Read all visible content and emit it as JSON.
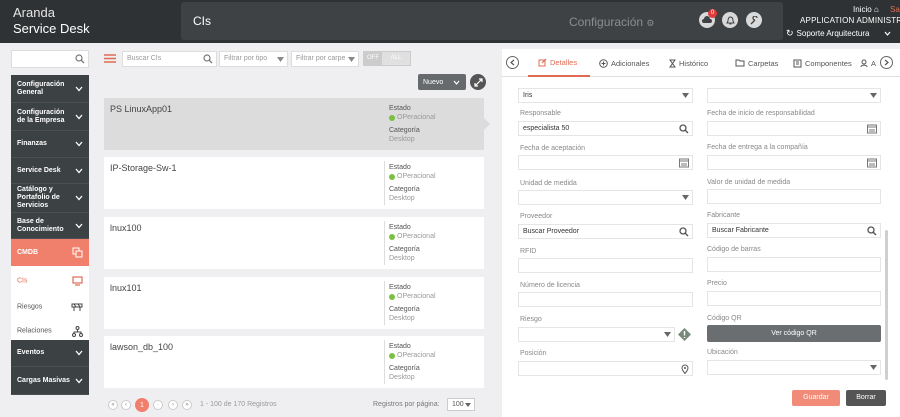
{
  "brand": {
    "line1": "Aranda",
    "line2": "Service Desk"
  },
  "header": {
    "module_title": "CIs",
    "config_label": "Configuración",
    "notification_count": "0",
    "home_link": "Inicio",
    "logout_link": "Sa",
    "user_name": "APPLICATION ADMINISTRAT",
    "project": "Soporte Arquitectura"
  },
  "sidebar": {
    "items": [
      {
        "label": "Configuración General"
      },
      {
        "label": "Configuración de la Empresa"
      },
      {
        "label": "Finanzas"
      },
      {
        "label": "Service Desk"
      },
      {
        "label": "Catálogo y Portafolio de Servicios"
      },
      {
        "label": "Base de Conocimiento"
      }
    ],
    "active": {
      "label": "CMDB"
    },
    "subitems": [
      {
        "label": "CIs"
      },
      {
        "label": "Riesgos"
      },
      {
        "label": "Relaciones"
      }
    ],
    "bottom": [
      {
        "label": "Eventos"
      },
      {
        "label": "Cargas Masivas"
      }
    ]
  },
  "toolbar": {
    "search_placeholder": "Buscar CIs",
    "filter_type_placeholder": "Filtrar por tipo",
    "filter_folder_placeholder": "Filtrar por carpe",
    "toggle_off": "OFF",
    "toggle_all": "ALL",
    "new_button": "Nuevo"
  },
  "list": {
    "state_label": "Estado",
    "category_label": "Categoría",
    "items": [
      {
        "name": "PS LinuxApp01",
        "state": "OPeracional",
        "category": "Desktop"
      },
      {
        "name": "IP-Storage-Sw-1",
        "state": "OPeracional",
        "category": "Desktop"
      },
      {
        "name": "lnux100",
        "state": "OPeracional",
        "category": "Desktop"
      },
      {
        "name": "lnux101",
        "state": "OPeracional",
        "category": "Desktop"
      },
      {
        "name": "lawson_db_100",
        "state": "OPeracional",
        "category": "Desktop"
      }
    ]
  },
  "pagination": {
    "current_page": "1",
    "range_text": "1 - 100 de 170 Registros",
    "page_size_label": "Registros por página:",
    "page_size": "100"
  },
  "tabs": [
    {
      "label": "Detalles"
    },
    {
      "label": "Adicionales"
    },
    {
      "label": "Histórico"
    },
    {
      "label": "Carpetas"
    },
    {
      "label": "Componentes"
    },
    {
      "label": "A"
    }
  ],
  "form": {
    "top_left_value": "Iris",
    "responsable_label": "Responsable",
    "responsable_value": "especialista 50",
    "fecha_inicio_label": "Fecha de inicio de responsabilidad",
    "fecha_aceptacion_label": "Fecha de aceptación",
    "fecha_entrega_label": "Fecha de entrega a la compañía",
    "unidad_label": "Unidad de medida",
    "valor_unidad_label": "Valor de unidad de medida",
    "proveedor_label": "Proveedor",
    "proveedor_value": "Buscar Proveedor",
    "fabricante_label": "Fabricante",
    "fabricante_value": "Buscar Fabricante",
    "rfid_label": "RFID",
    "codigo_barras_label": "Código de barras",
    "licencia_label": "Número de licencia",
    "precio_label": "Precio",
    "riesgo_label": "Riesgo",
    "codigo_qr_label": "Código QR",
    "ver_qr_button": "Ver código QR",
    "posicion_label": "Posición",
    "ubicacion_label": "Ubicación"
  },
  "actions": {
    "save": "Guardar",
    "delete": "Borrar"
  }
}
